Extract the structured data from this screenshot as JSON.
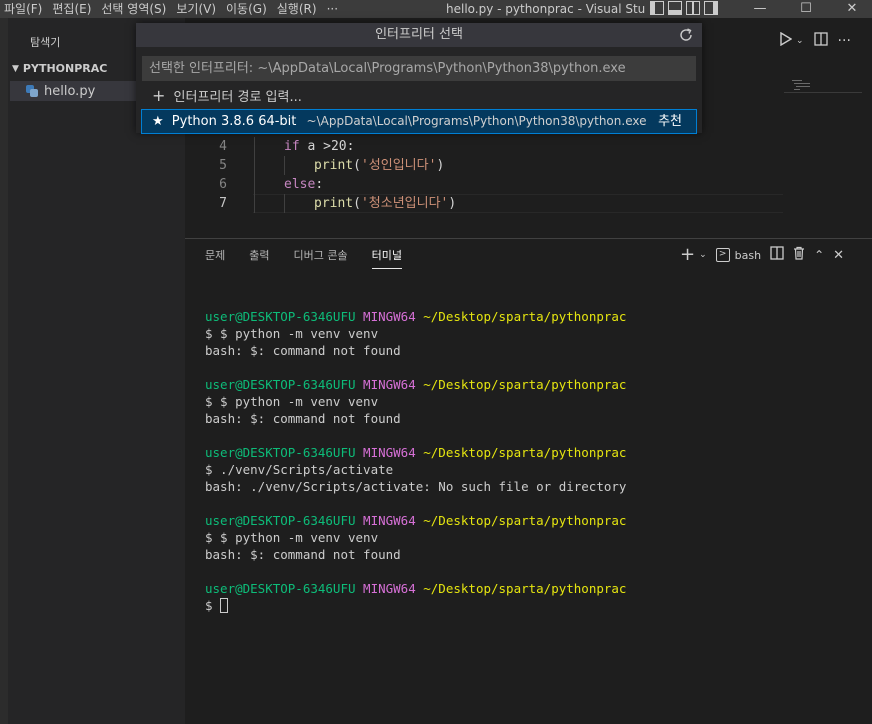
{
  "menu": [
    "파일(F)",
    "편집(E)",
    "선택 영역(S)",
    "보기(V)",
    "이동(G)",
    "실행(R)",
    "···"
  ],
  "window_title": "hello.py - pythonprac - Visual Stu",
  "window_controls": {
    "minimize": "—",
    "maximize": "☐",
    "close": "✕"
  },
  "sidebar": {
    "title": "탐색기",
    "folder": "PYTHONPRAC",
    "files": [
      {
        "name": "hello.py"
      }
    ]
  },
  "editor": {
    "lines": [
      {
        "num": "4",
        "indent": 1,
        "tokens": [
          {
            "t": "if",
            "c": "kw"
          },
          {
            "t": " a >20",
            "c": "plain"
          },
          {
            "t": ":",
            "c": "plain"
          }
        ]
      },
      {
        "num": "5",
        "indent": 2,
        "tokens": [
          {
            "t": "print",
            "c": "fn"
          },
          {
            "t": "(",
            "c": "plain"
          },
          {
            "t": "'성인입니다'",
            "c": "str"
          },
          {
            "t": ")",
            "c": "plain"
          }
        ]
      },
      {
        "num": "6",
        "indent": 1,
        "tokens": [
          {
            "t": "else",
            "c": "kw"
          },
          {
            "t": ":",
            "c": "plain"
          }
        ]
      },
      {
        "num": "7",
        "indent": 2,
        "tokens": [
          {
            "t": "print",
            "c": "fn"
          },
          {
            "t": "(",
            "c": "plain"
          },
          {
            "t": "'청소년입니다'",
            "c": "str"
          },
          {
            "t": ")",
            "c": "plain"
          }
        ]
      }
    ],
    "current_line": "7"
  },
  "panel": {
    "tabs": [
      "문제",
      "출력",
      "디버그 콘솔",
      "터미널"
    ],
    "active_tab": "터미널",
    "shell": "bash"
  },
  "terminal": {
    "user": "user@DESKTOP-6346UFU",
    "env": "MINGW64",
    "path": "~/Desktop/sparta/pythonprac",
    "blocks": [
      {
        "cmd": "$ $ python -m venv venv",
        "out": "bash: $: command not found"
      },
      {
        "cmd": "$ $ python -m venv venv",
        "out": "bash: $: command not found"
      },
      {
        "cmd": "$ ./venv/Scripts/activate",
        "out": "bash: ./venv/Scripts/activate: No such file or directory"
      },
      {
        "cmd": "$ $ python -m venv venv",
        "out": "bash: $: command not found"
      }
    ],
    "prompt": "$"
  },
  "quickpick": {
    "title": "인터프리터 선택",
    "input_value": "선택한 인터프리터: ~\\AppData\\Local\\Programs\\Python\\Python38\\python.exe",
    "items": [
      {
        "label": "인터프리터 경로 입력..."
      },
      {
        "label": "Python 3.8.6 64-bit",
        "description": "~\\AppData\\Local\\Programs\\Python\\Python38\\python.exe",
        "badge": "추천"
      }
    ]
  }
}
